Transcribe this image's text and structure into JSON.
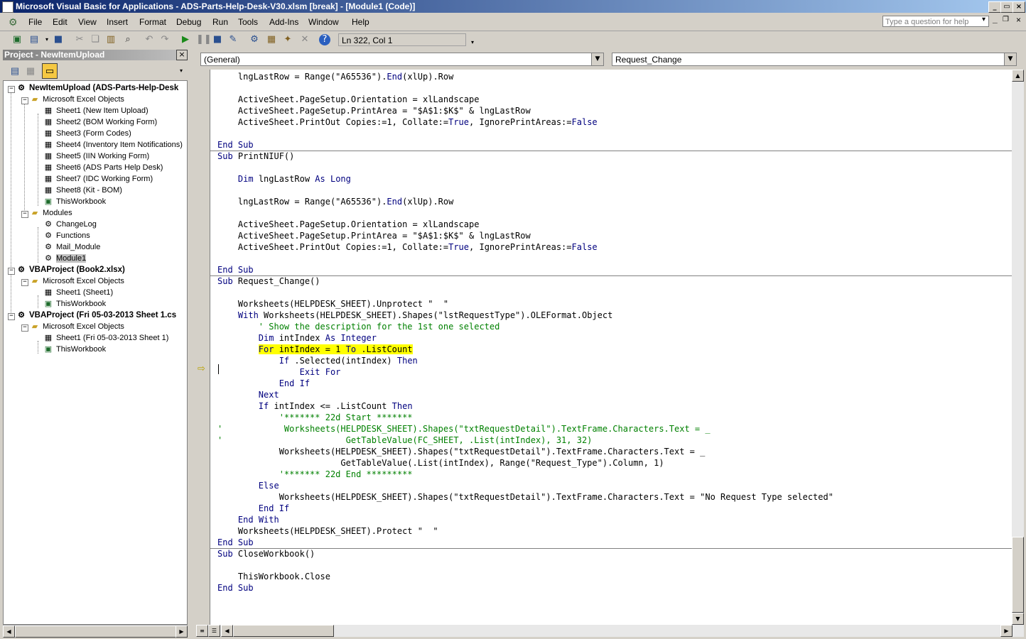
{
  "window": {
    "title": "Microsoft Visual Basic for Applications - ADS-Parts-Help-Desk-V30.xlsm [break] - [Module1 (Code)]",
    "min": "_",
    "restore": "▭",
    "close": "×"
  },
  "menu": {
    "items": [
      "File",
      "Edit",
      "View",
      "Insert",
      "Format",
      "Debug",
      "Run",
      "Tools",
      "Add-Ins",
      "Window",
      "Help"
    ],
    "help_placeholder": "Type a question for help"
  },
  "toolbar": {
    "position": "Ln 322, Col 1"
  },
  "project": {
    "title": "Project - NewItemUpload",
    "tree": [
      {
        "label": "NewItemUpload (ADS-Parts-Help-Desk",
        "bold": true
      },
      {
        "label": "Microsoft Excel Objects"
      },
      {
        "label": "Sheet1 (New Item Upload)"
      },
      {
        "label": "Sheet2 (BOM Working Form)"
      },
      {
        "label": "Sheet3 (Form Codes)"
      },
      {
        "label": "Sheet4 (Inventory Item Notifications)"
      },
      {
        "label": "Sheet5 (IIN Working Form)"
      },
      {
        "label": "Sheet6 (ADS Parts Help Desk)"
      },
      {
        "label": "Sheet7 (IDC Working Form)"
      },
      {
        "label": "Sheet8 (Kit - BOM)"
      },
      {
        "label": "ThisWorkbook"
      },
      {
        "label": "Modules"
      },
      {
        "label": "ChangeLog"
      },
      {
        "label": "Functions"
      },
      {
        "label": "Mail_Module"
      },
      {
        "label": "Module1"
      },
      {
        "label": "VBAProject (Book2.xlsx)",
        "bold": true
      },
      {
        "label": "Microsoft Excel Objects"
      },
      {
        "label": "Sheet1 (Sheet1)"
      },
      {
        "label": "ThisWorkbook"
      },
      {
        "label": "VBAProject (Fri 05-03-2013  Sheet 1.cs",
        "bold": true
      },
      {
        "label": "Microsoft Excel Objects"
      },
      {
        "label": "Sheet1 (Fri 05-03-2013  Sheet 1)"
      },
      {
        "label": "ThisWorkbook"
      }
    ]
  },
  "code_window": {
    "object_combo": "(General)",
    "proc_combo": "Request_Change",
    "lines": [
      "    lngLastRow = Range(\"A65536\").End(xlUp).Row",
      "",
      "    ActiveSheet.PageSetup.Orientation = xlLandscape",
      "    ActiveSheet.PageSetup.PrintArea = \"$A$1:$K$\" & lngLastRow",
      "    ActiveSheet.PrintOut Copies:=1, Collate:=True, IgnorePrintAreas:=False",
      "",
      "End Sub",
      "Sub PrintNIUF()",
      "",
      "    Dim lngLastRow As Long",
      "",
      "    lngLastRow = Range(\"A65536\").End(xlUp).Row",
      "",
      "    ActiveSheet.PageSetup.Orientation = xlLandscape",
      "    ActiveSheet.PageSetup.PrintArea = \"$A$1:$K$\" & lngLastRow",
      "    ActiveSheet.PrintOut Copies:=1, Collate:=True, IgnorePrintAreas:=False",
      "",
      "End Sub",
      "Sub Request_Change()",
      "",
      "    Worksheets(HELPDESK_SHEET).Unprotect \"  \"",
      "    With Worksheets(HELPDESK_SHEET).Shapes(\"lstRequestType\").OLEFormat.Object",
      "        ' Show the description for the 1st one selected",
      "        Dim intIndex As Integer",
      "        For intIndex = 1 To .ListCount",
      "            If .Selected(intIndex) Then",
      "                Exit For",
      "            End If",
      "        Next",
      "        If intIndex <= .ListCount Then",
      "            '******* 22d Start *******",
      "'            Worksheets(HELPDESK_SHEET).Shapes(\"txtRequestDetail\").TextFrame.Characters.Text = _",
      "'                        GetTableValue(FC_SHEET, .List(intIndex), 31, 32)",
      "            Worksheets(HELPDESK_SHEET).Shapes(\"txtRequestDetail\").TextFrame.Characters.Text = _",
      "                        GetTableValue(.List(intIndex), Range(\"Request_Type\").Column, 1)",
      "            '******* 22d End *********",
      "        Else",
      "            Worksheets(HELPDESK_SHEET).Shapes(\"txtRequestDetail\").TextFrame.Characters.Text = \"No Request Type selected\"",
      "        End If",
      "    End With",
      "    Worksheets(HELPDESK_SHEET).Protect \"  \"",
      "End Sub",
      "Sub CloseWorkbook()",
      "",
      "    ThisWorkbook.Close",
      "End Sub"
    ],
    "current_line_index": 24
  }
}
